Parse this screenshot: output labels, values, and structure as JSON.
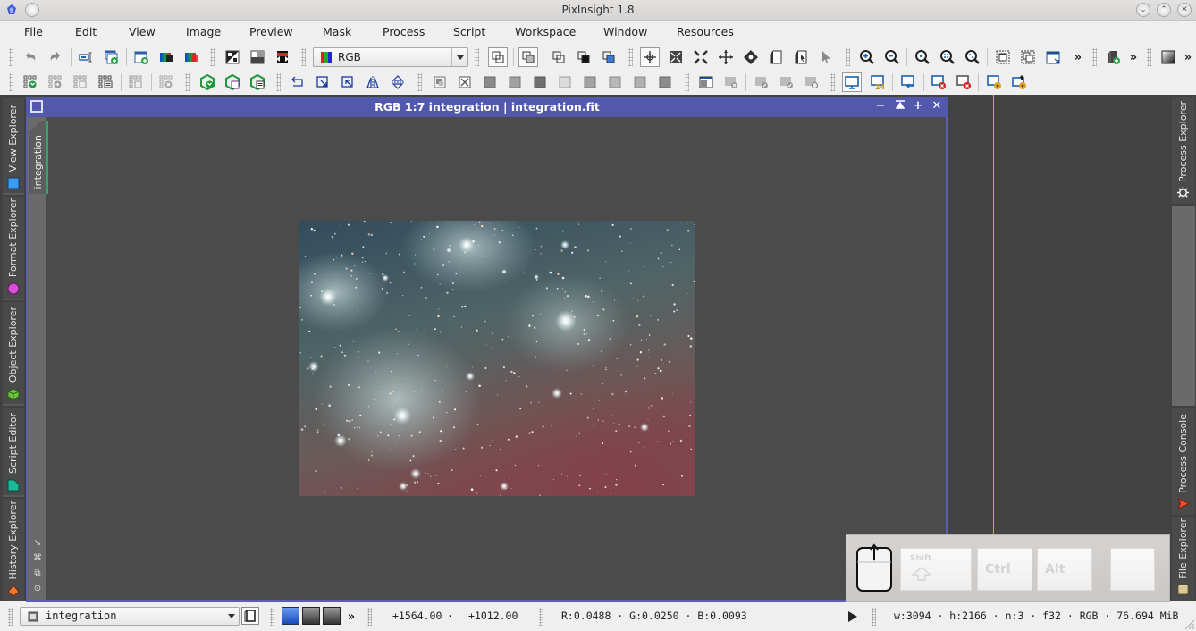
{
  "window": {
    "title": "PixInsight 1.8",
    "controls": [
      "minimize",
      "maximize",
      "close"
    ]
  },
  "menu": [
    "File",
    "Edit",
    "View",
    "Image",
    "Preview",
    "Mask",
    "Process",
    "Script",
    "Workspace",
    "Window",
    "Resources"
  ],
  "toolbar": {
    "channel_combo": {
      "value": "RGB",
      "icon": "rgb-channels-icon"
    },
    "overflow_label": "»",
    "row1_icons": [
      "undo-icon",
      "redo-icon",
      "new-view-identifier-icon",
      "new-image-window-icon",
      "new-image-icon",
      "duplicate-image-icon",
      "duplicate-rgb-icon",
      "invert-icon",
      "gray-gradient-icon",
      "swap-channels-icon",
      "rgb-channels-icon",
      "layer-icon",
      "layer-masked-icon",
      "preview-select-icon",
      "preview-mask-icon",
      "preview-blue-icon",
      "readout-mode-icon",
      "zoom-fit-icon",
      "zoom-in-mode-icon",
      "pan-mode-icon",
      "center-mode-icon",
      "page-icon",
      "page-cursor-icon",
      "pointer-icon",
      "zoom-in-icon",
      "zoom-out-icon",
      "zoom-1-1-icon",
      "zoom-plus-icon",
      "zoom-fit-window-icon",
      "window-frame-icon",
      "window-cascade-icon",
      "window-shrink-icon",
      "new-process-icon",
      "gradient-icon"
    ],
    "row2_icons": [
      "project-open-icon",
      "project-add-icon",
      "project-save-icon",
      "project-list-icon",
      "project-save-as-icon",
      "project-close-icon",
      "process-open-icon",
      "process-save-icon",
      "process-list-icon",
      "rotate-left-icon",
      "rotate-corner-icon",
      "rotate-corner2-icon",
      "mirror-horizontal-icon",
      "mirror-vertical-icon",
      "mask-apply-icon",
      "mask-remove-icon",
      "stf-gray-1-icon",
      "stf-gray-2-icon",
      "stf-gray-3-icon",
      "stf-gray-4-icon",
      "stf-gray-5-icon",
      "stf-gray-6-icon",
      "stf-gray-7-icon",
      "stf-gray-8-icon",
      "mask-window-icon",
      "mask-delete-icon",
      "mask-edit-icon",
      "mask-check-icon",
      "mask-search-icon",
      "display-icon",
      "display-24bit-icon",
      "display-import-icon",
      "display-close-icon",
      "display-close-all-icon",
      "display-radiation-icon",
      "display-radiation-up-icon"
    ]
  },
  "left_dock": {
    "tabs": [
      {
        "label": "View Explorer",
        "icon": "view-explorer-icon",
        "color": "#3a8ee8"
      },
      {
        "label": "Format Explorer",
        "icon": "format-explorer-icon",
        "color": "#d64fd6"
      },
      {
        "label": "Object Explorer",
        "icon": "object-explorer-icon",
        "color": "#6ec43c"
      },
      {
        "label": "Script Editor",
        "icon": "script-editor-icon",
        "color": "#1db89a"
      },
      {
        "label": "History Explorer",
        "icon": "history-explorer-icon",
        "color": "#f07a30"
      }
    ]
  },
  "right_dock": {
    "tabs": [
      {
        "label": "Process Explorer",
        "icon": "gear-icon"
      },
      {
        "label": "Process Console",
        "icon": "process-console-icon"
      },
      {
        "label": "File Explorer",
        "icon": "file-explorer-icon"
      }
    ]
  },
  "image_window": {
    "title": "RGB 1:7 integration | integration.fit",
    "view_tab_label": "integration",
    "caption_buttons": [
      "−",
      "⯭",
      "+",
      "✕"
    ],
    "side_icons": [
      "shrink-icon",
      "fit-icon",
      "restore-icon",
      "target-icon"
    ]
  },
  "keyboard_overlay": {
    "keys": [
      "Shift",
      "Ctrl",
      "Alt",
      ""
    ],
    "mouse_icon": "mouse-icon"
  },
  "statusbar": {
    "view_selector": "integration",
    "coords": {
      "x": "+1564.00",
      "sep": "·",
      "y": "+1012.00"
    },
    "pixel_values": "R:0.0488 · G:0.0250 · B:0.0093",
    "image_info": "w:3094 · h:2166 · n:3 · f32 · RGB · 76.694 MiB",
    "overflow": "»"
  },
  "colors": {
    "caption": "#5259ad",
    "workspace": "#434343",
    "accent_green": "#2fa86a"
  }
}
